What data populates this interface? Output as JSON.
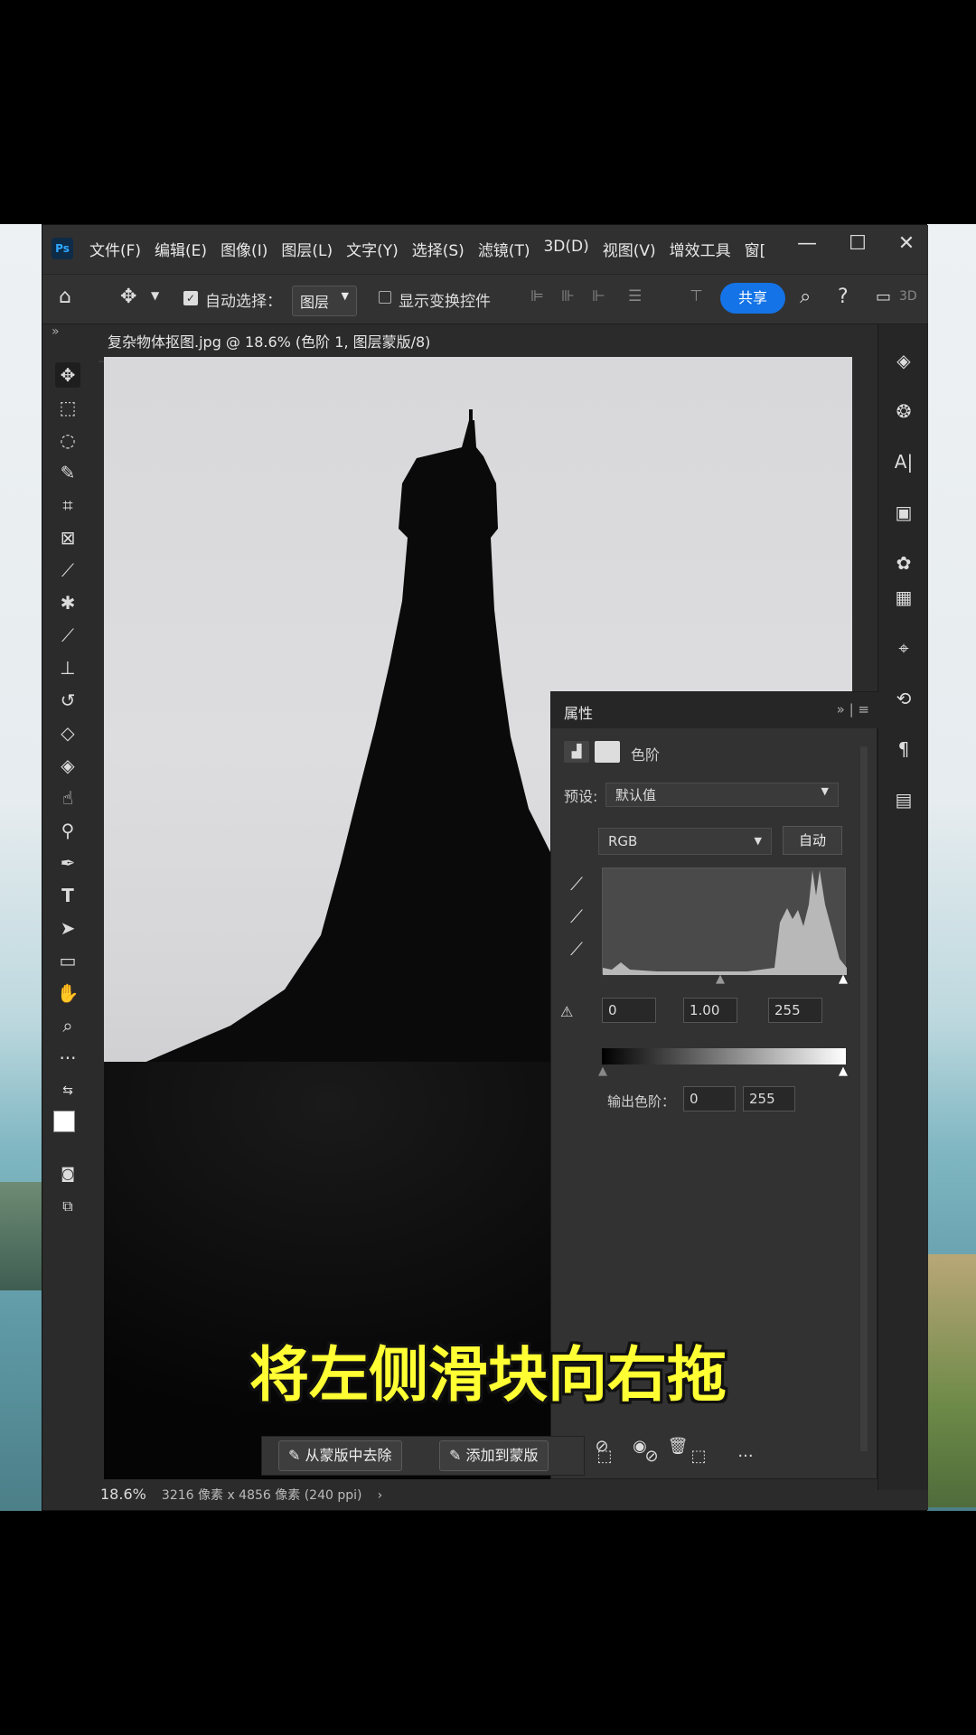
{
  "app": {
    "logo_text": "Ps"
  },
  "menu": [
    "文件(F)",
    "编辑(E)",
    "图像(I)",
    "图层(L)",
    "文字(Y)",
    "选择(S)",
    "滤镜(T)",
    "3D(D)",
    "视图(V)",
    "增效工具",
    "窗["
  ],
  "options": {
    "auto_select_label": "自动选择：",
    "layer_dropdown": "图层",
    "show_transform_label": "显示变换控件",
    "share_label": "共享",
    "three_d_label": "3D"
  },
  "document": {
    "tab_title": "复杂物体抠图.jpg @ 18.6% (色阶 1, 图层蒙版/8) *",
    "zoom": "18.6%",
    "dimensions": "3216 像素 x 4856 像素 (240 ppi)"
  },
  "properties": {
    "title": "属性",
    "sub_title": "色阶",
    "preset_label": "预设:",
    "preset_value": "默认值",
    "channel": "RGB",
    "auto_label": "自动",
    "input_black": "0",
    "input_gamma": "1.00",
    "input_white": "255",
    "output_label": "输出色阶：",
    "output_black": "0",
    "output_white": "255"
  },
  "mask_bar": {
    "remove_label": "从蒙版中去除",
    "add_label": "添加到蒙版"
  },
  "caption": "将左侧滑块向右拖",
  "colors": {
    "accent": "#1473e6",
    "caption": "#ffff33"
  }
}
